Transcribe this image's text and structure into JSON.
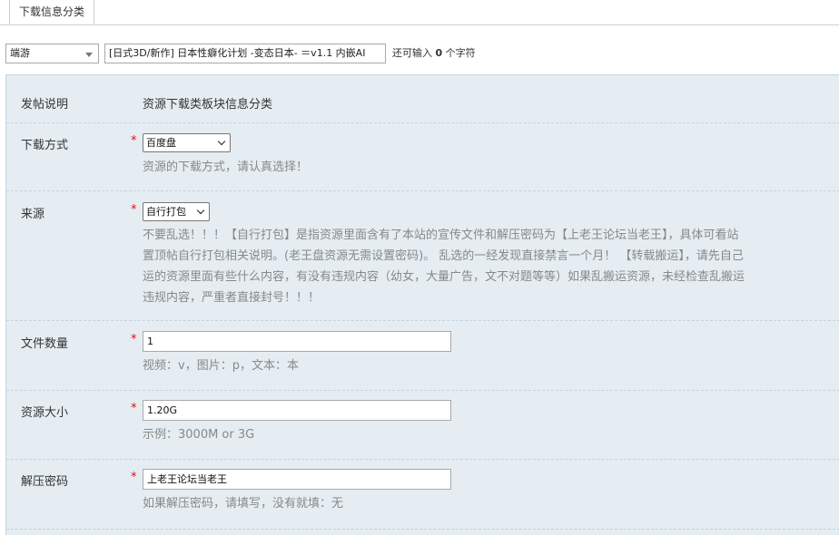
{
  "tab": {
    "label": "下载信息分类"
  },
  "thread_type": {
    "selected": "端游"
  },
  "title_input": {
    "value": "[日式3D/新作] 日本性癖化计划 -变态日本- ＝v1.1 内嵌AI"
  },
  "char_hint": {
    "prefix": "还可输入",
    "count": "0",
    "suffix": "个字符"
  },
  "info": {
    "posting_note": {
      "label": "发帖说明",
      "value": "资源下载类板块信息分类"
    },
    "download_method": {
      "label": "下载方式",
      "required": "*",
      "selected": "百度盘",
      "hint": "资源的下载方式，请认真选择！"
    },
    "source": {
      "label": "来源",
      "required": "*",
      "selected": "自行打包",
      "hint_lines": [
        "不要乱选！！！【自行打包】是指资源里面含有了本站的宣传文件和解压密码为【上老王论坛当老王】，具体可看站",
        "置顶帖自行打包相关说明。(老王盘资源无需设置密码)。 乱选的一经发现直接禁言一个月！ 【转载搬运】，请先自己",
        "运的资源里面有些什么内容，有没有违规内容（幼女，大量广告，文不对题等等）如果乱搬运资源，未经检查乱搬运",
        "违规内容，严重者直接封号！！！"
      ]
    },
    "file_count": {
      "label": "文件数量",
      "required": "*",
      "value": "1",
      "hint": "视频：v，图片：p，文本：本"
    },
    "resource_size": {
      "label": "资源大小",
      "required": "*",
      "value": "1.20G",
      "hint": "示例：3000M or 3G"
    },
    "unzip_password": {
      "label": "解压密码",
      "required": "*",
      "value": "上老王论坛当老王",
      "hint": "如果解压密码，请填写，没有就填：无"
    }
  },
  "colors": {
    "panel_bg": "#e5edf2",
    "required": "#ff0000",
    "hint_text": "#888888"
  }
}
